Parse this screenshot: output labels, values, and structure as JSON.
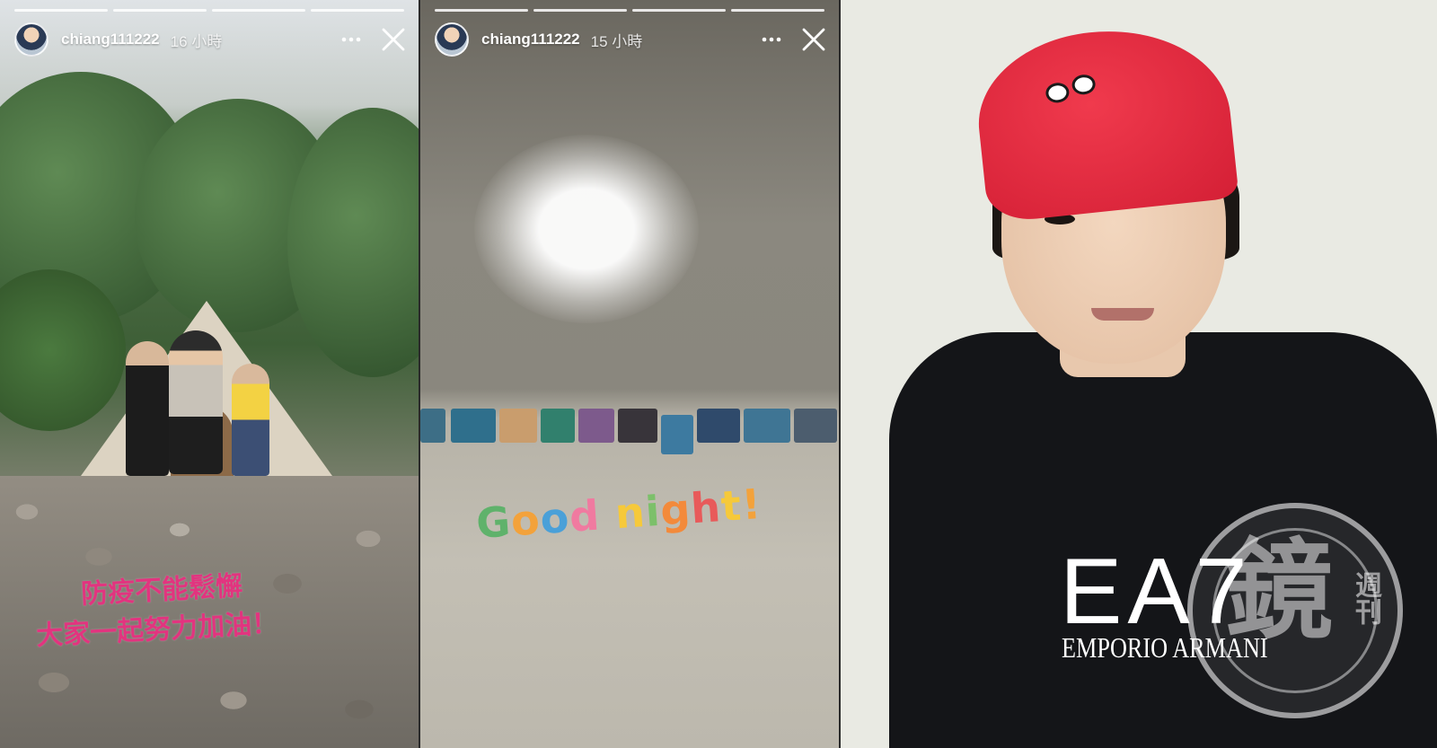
{
  "stories": [
    {
      "username": "chiang111222",
      "timestamp": "16 小時",
      "progress_segments": 4,
      "more_icon": "more-horizontal-icon",
      "close_icon": "close-icon",
      "caption_lines": [
        "防疫不能鬆懈",
        "大家一起努力加油！"
      ]
    },
    {
      "username": "chiang111222",
      "timestamp": "15 小時",
      "progress_segments": 4,
      "more_icon": "more-horizontal-icon",
      "close_icon": "close-icon",
      "sticker_text": "Good night!",
      "sticker_colors": [
        "#5fb26b",
        "#f3a23b",
        "#4aa0d8",
        "#f07aa0",
        "#f6c93a",
        "#7cc06a",
        "#f38a3b",
        "#e85a5a",
        "#f6c93a",
        "#f3a23b",
        "#4aa0d8"
      ]
    }
  ],
  "photo": {
    "shirt_brand": "EA7",
    "shirt_sub": "EMPORIO ARMANI",
    "cap_color": "#e32a3f"
  },
  "watermark": {
    "glyph": "鏡",
    "side_text": "週刊"
  },
  "colors": {
    "caption_pink": "#e2347f",
    "header_text": "#ffffff"
  }
}
